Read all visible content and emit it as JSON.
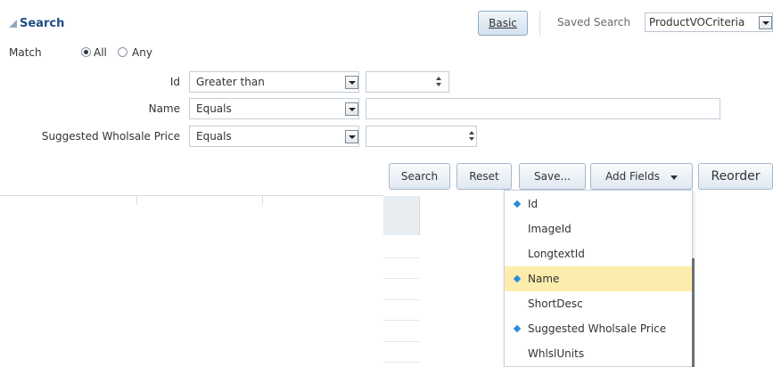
{
  "header": {
    "title": "Search",
    "basic_button": "Basic",
    "saved_search_label": "Saved Search",
    "saved_search_value": "ProductVOCriteria"
  },
  "match": {
    "label": "Match",
    "all_label": "All",
    "any_label": "Any",
    "selected": "All"
  },
  "criteria": [
    {
      "label": "Id",
      "operator": "Greater than",
      "value": ""
    },
    {
      "label": "Name",
      "operator": "Equals",
      "value": ""
    },
    {
      "label": "Suggested Wholsale Price",
      "operator": "Equals",
      "value": ""
    }
  ],
  "actions": {
    "search": "Search",
    "reset": "Reset",
    "save": "Save...",
    "add_fields": "Add Fields",
    "reorder": "Reorder"
  },
  "add_fields_menu": {
    "items": [
      {
        "label": "Id",
        "selected": true,
        "highlighted": false
      },
      {
        "label": "ImageId",
        "selected": false,
        "highlighted": false
      },
      {
        "label": "LongtextId",
        "selected": false,
        "highlighted": false
      },
      {
        "label": "Name",
        "selected": true,
        "highlighted": true
      },
      {
        "label": "ShortDesc",
        "selected": false,
        "highlighted": false
      },
      {
        "label": "Suggested Wholsale Price",
        "selected": true,
        "highlighted": false
      },
      {
        "label": "WhlslUnits",
        "selected": false,
        "highlighted": false
      }
    ]
  },
  "colors": {
    "title": "#1f4d86",
    "menu_highlight": "#fdedad",
    "selected_marker": "#2a8be0"
  }
}
